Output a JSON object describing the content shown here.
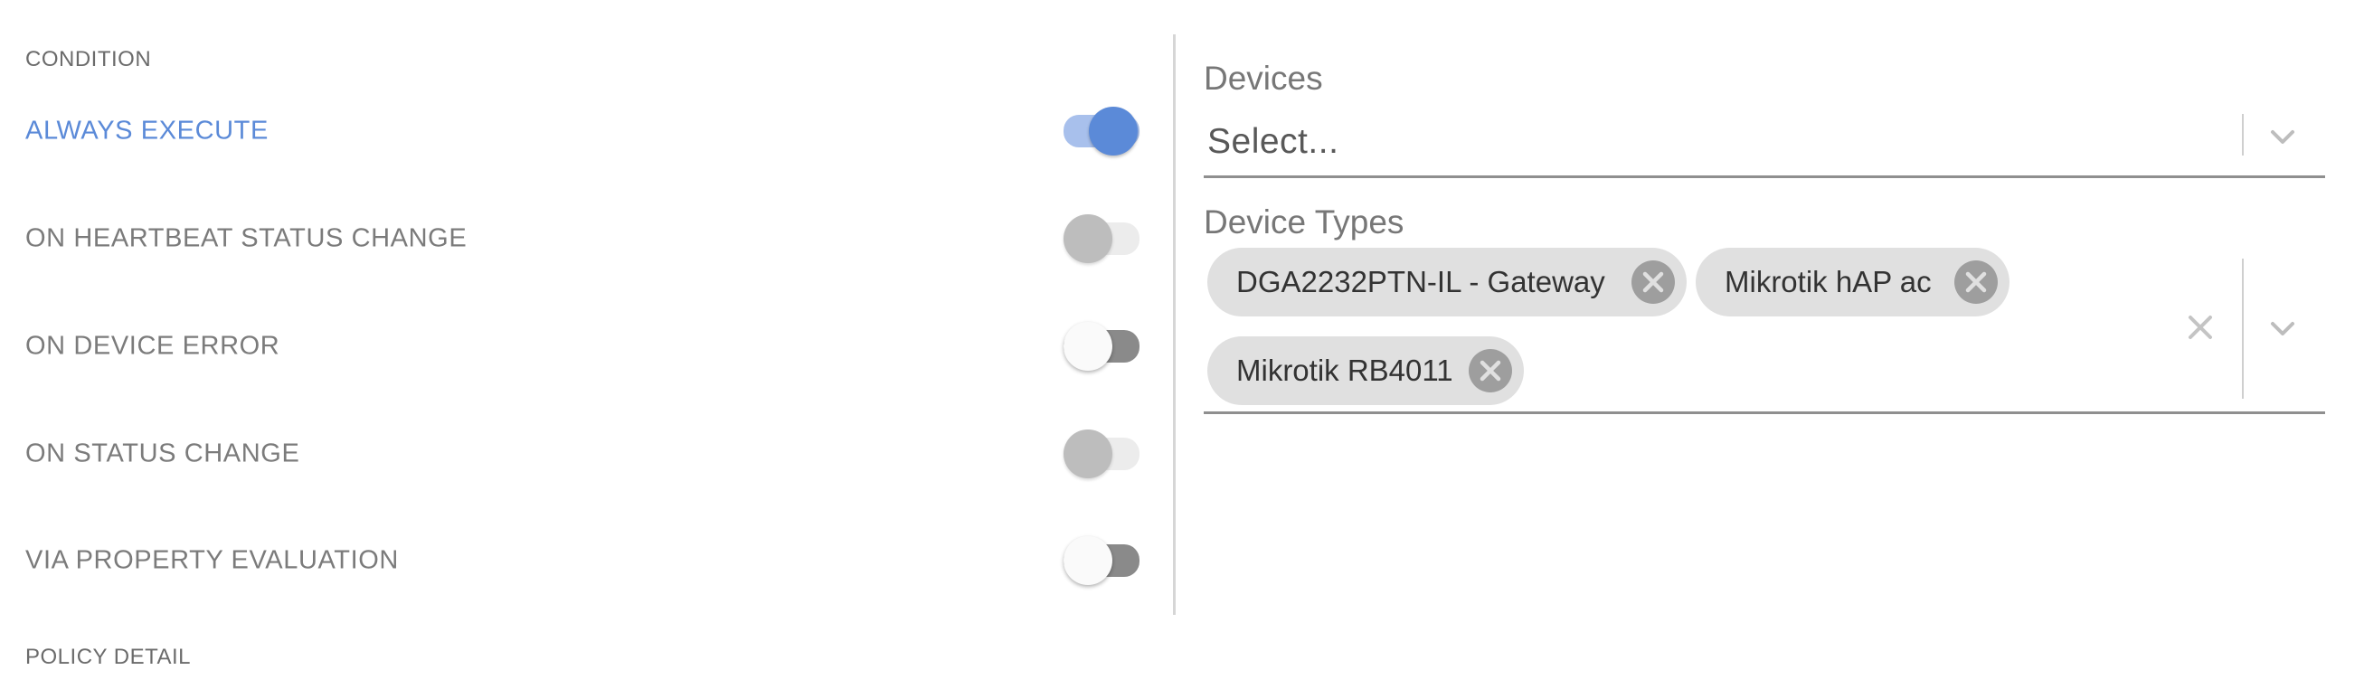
{
  "condition_section": {
    "title": "CONDITION",
    "rows": [
      {
        "label": "ALWAYS EXECUTE",
        "state": "on"
      },
      {
        "label": "ON HEARTBEAT STATUS CHANGE",
        "state": "disabled-off"
      },
      {
        "label": "ON DEVICE ERROR",
        "state": "off"
      },
      {
        "label": "ON STATUS CHANGE",
        "state": "disabled-off"
      },
      {
        "label": "VIA PROPERTY EVALUATION",
        "state": "off"
      }
    ]
  },
  "policy_detail_section": {
    "title": "POLICY DETAIL"
  },
  "devices_field": {
    "label": "Devices",
    "placeholder": "Select..."
  },
  "device_types_field": {
    "label": "Device Types",
    "chips": [
      {
        "label": "DGA2232PTN-IL - Gateway"
      },
      {
        "label": "Mikrotik hAP ac"
      },
      {
        "label": "Mikrotik RB4011"
      }
    ]
  },
  "icons": {
    "chip_delete": "circle-x-icon",
    "dropdown": "chevron-down-icon",
    "clear": "close-icon"
  },
  "colors": {
    "accent": "#5b8ad8",
    "accent_track": "#a8c0ec",
    "chip_bg": "#e0e0e0",
    "text_muted": "#7b7b7b"
  }
}
